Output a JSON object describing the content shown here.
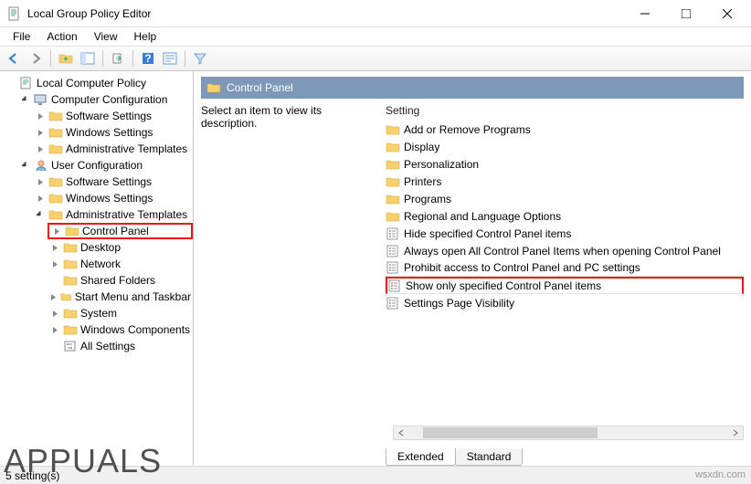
{
  "window": {
    "title": "Local Group Policy Editor"
  },
  "menu": {
    "file": "File",
    "action": "Action",
    "view": "View",
    "help": "Help"
  },
  "tree": {
    "root": "Local Computer Policy",
    "cc": "Computer Configuration",
    "cc_sw": "Software Settings",
    "cc_win": "Windows Settings",
    "cc_at": "Administrative Templates",
    "uc": "User Configuration",
    "uc_sw": "Software Settings",
    "uc_win": "Windows Settings",
    "uc_at": "Administrative Templates",
    "cp": "Control Panel",
    "desk": "Desktop",
    "net": "Network",
    "sf": "Shared Folders",
    "smt": "Start Menu and Taskbar",
    "sys": "System",
    "wcomp": "Windows Components",
    "all": "All Settings"
  },
  "detail": {
    "header": "Control Panel",
    "desc": "Select an item to view its description.",
    "col_setting": "Setting",
    "folders": [
      "Add or Remove Programs",
      "Display",
      "Personalization",
      "Printers",
      "Programs",
      "Regional and Language Options"
    ],
    "settings": [
      "Hide specified Control Panel items",
      "Always open All Control Panel Items when opening Control Panel",
      "Prohibit access to Control Panel and PC settings",
      "Show only specified Control Panel items",
      "Settings Page Visibility"
    ],
    "highlight_index": 3
  },
  "tabs": {
    "extended": "Extended",
    "standard": "Standard"
  },
  "status": "5 setting(s)",
  "watermark_left": "APPUALS",
  "watermark_right": "wsxdn.com"
}
